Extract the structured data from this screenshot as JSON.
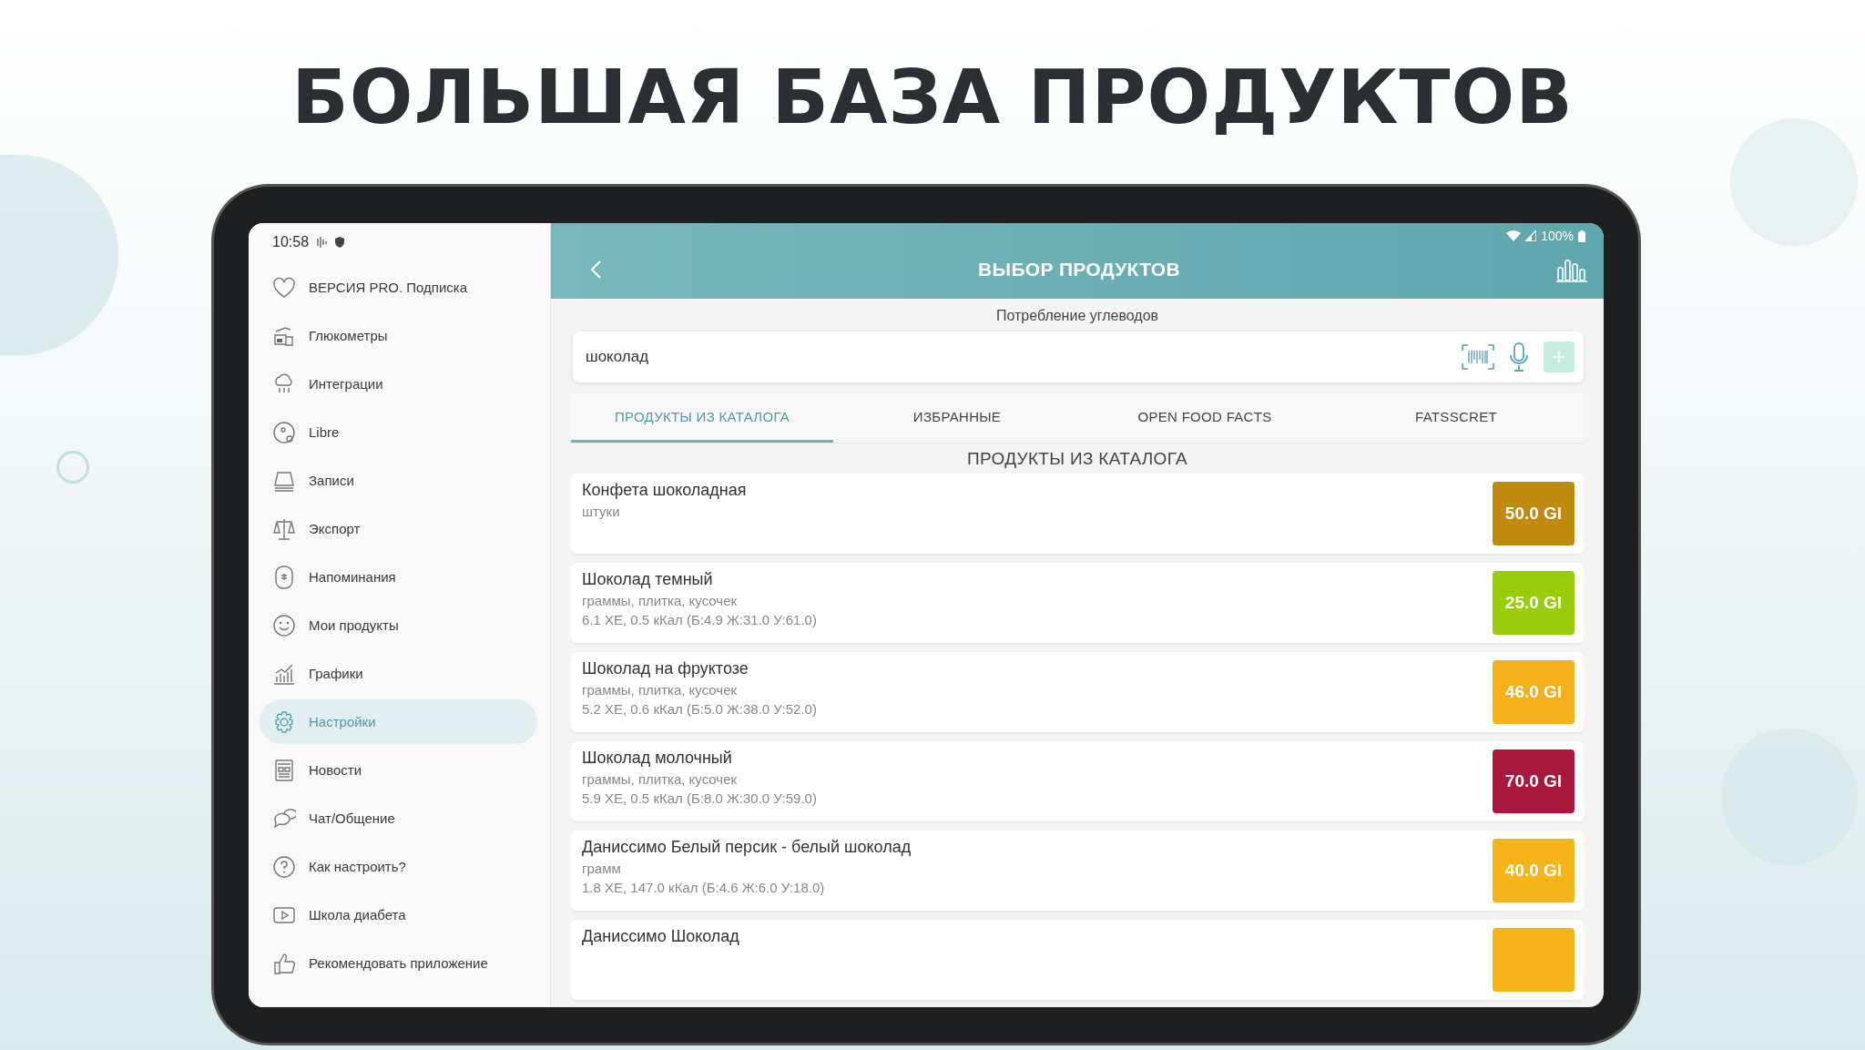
{
  "headline": "БОЛЬШАЯ БАЗА ПРОДУКТОВ",
  "status_bar": {
    "time": "10:58",
    "battery": "100%"
  },
  "sidebar": {
    "items": [
      {
        "label": "ВЕРСИЯ PRO. Подписка",
        "selected": false
      },
      {
        "label": "Глюкометры",
        "selected": false
      },
      {
        "label": "Интеграции",
        "selected": false
      },
      {
        "label": "Libre",
        "selected": false
      },
      {
        "label": "Записи",
        "selected": false
      },
      {
        "label": "Экспорт",
        "selected": false
      },
      {
        "label": "Напоминания",
        "selected": false
      },
      {
        "label": "Мои продукты",
        "selected": false
      },
      {
        "label": "Графики",
        "selected": false
      },
      {
        "label": "Настройки",
        "selected": true
      },
      {
        "label": "Новости",
        "selected": false
      },
      {
        "label": "Чат/Общение",
        "selected": false
      },
      {
        "label": "Как настроить?",
        "selected": false
      },
      {
        "label": "Школа диабета",
        "selected": false
      },
      {
        "label": "Рекомендовать приложение",
        "selected": false
      }
    ]
  },
  "header": {
    "title": "ВЫБОР ПРОДУКТОВ"
  },
  "subtitle": "Потребление углеводов",
  "search": {
    "value": "шоколад"
  },
  "tabs": [
    {
      "label": "ПРОДУКТЫ ИЗ КАТАЛОГА",
      "selected": true
    },
    {
      "label": "ИЗБРАННЫЕ",
      "selected": false
    },
    {
      "label": "OPEN FOOD FACTS",
      "selected": false
    },
    {
      "label": "FATSSCRET",
      "selected": false
    }
  ],
  "section_title": "ПРОДУКТЫ ИЗ КАТАЛОГА",
  "products": [
    {
      "name": "Конфета шоколадная",
      "units": "штуки",
      "gi": "50.0 GI",
      "color": "#c08a0e"
    },
    {
      "name": "Шоколад темный",
      "units": "граммы, плитка, кусочек",
      "nutrition": "6.1 ХЕ, 0.5 кКал (Б:4.9 Ж:31.0 У:61.0)",
      "gi": "25.0 GI",
      "color": "#99cc0a"
    },
    {
      "name": "Шоколад на фруктозе",
      "units": "граммы, плитка, кусочек",
      "nutrition": "5.2 ХЕ, 0.6 кКал (Б:5.0 Ж:38.0 У:52.0)",
      "gi": "46.0 GI",
      "color": "#f5b11c"
    },
    {
      "name": "Шоколад молочный",
      "units": "граммы, плитка, кусочек",
      "nutrition": "5.9 ХЕ, 0.5 кКал (Б:8.0 Ж:30.0 У:59.0)",
      "gi": "70.0 GI",
      "color": "#a8183c"
    },
    {
      "name": "Даниссимо Белый персик - белый шоколад",
      "units": "грамм",
      "nutrition": "1.8 ХЕ, 147.0 кКал (Б:4.6 Ж:6.0 У:18.0)",
      "gi": "40.0 GI",
      "color": "#f5b51a"
    },
    {
      "name": "Даниссимо Шоколад",
      "color": "#f5b51a"
    }
  ]
}
